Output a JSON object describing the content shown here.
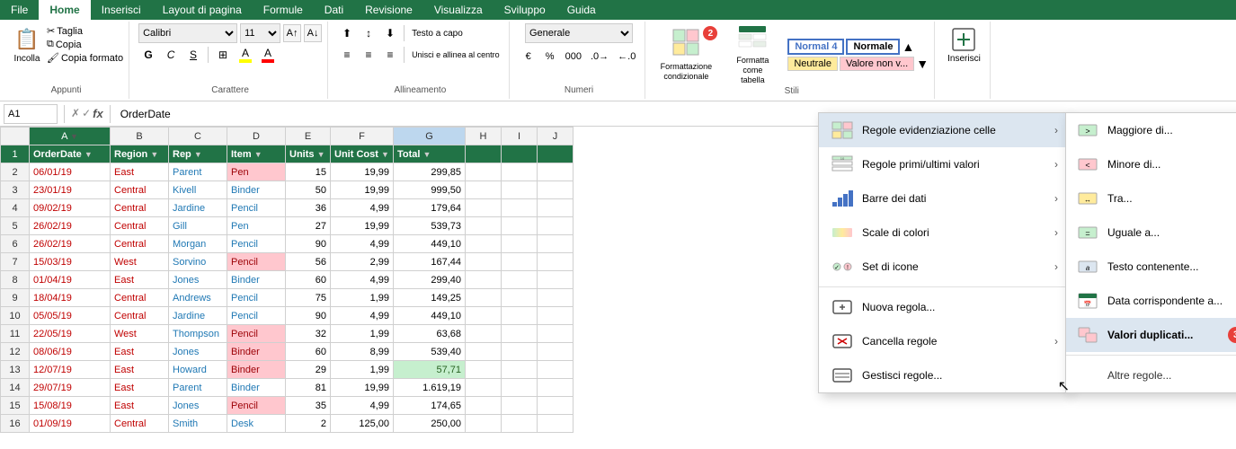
{
  "ribbon": {
    "tabs": [
      "File",
      "Home",
      "Inserisci",
      "Layout di pagina",
      "Formule",
      "Dati",
      "Revisione",
      "Visualizza",
      "Sviluppo",
      "Guida"
    ],
    "active_tab": "Home",
    "groups": {
      "appunti": {
        "label": "Appunti",
        "paste_label": "Incolla",
        "cut_label": "Taglia",
        "copy_label": "Copia",
        "copy_format_label": "Copia formato"
      },
      "carattere": {
        "label": "Carattere",
        "font": "Calibri",
        "size": "11",
        "bold": "G",
        "italic": "C",
        "underline": "S",
        "highlight_color": "#ffff00",
        "font_color": "#ff0000"
      },
      "allineamento": {
        "label": "Allineamento",
        "wrap_text": "Testo a capo",
        "merge": "Unisci e allinea al centro"
      },
      "numeri": {
        "label": "Numeri",
        "format": "Generale"
      },
      "stili": {
        "label": "Stili",
        "cf_label": "Formattazione\ncondizionale",
        "format_as_table_label": "Formatta come\ntabella",
        "normal4": "Normal 4",
        "normale": "Normale",
        "neutrale": "Neutrale",
        "valore_non_v": "Valore non v..."
      }
    }
  },
  "formula_bar": {
    "cell_ref": "A1",
    "formula": "OrderDate"
  },
  "columns": [
    "A",
    "B",
    "C",
    "D",
    "E",
    "F",
    "G",
    "H",
    "I",
    "J"
  ],
  "column_headers": [
    "OrderDate",
    "Region",
    "Rep",
    "Item",
    "Units",
    "Unit Cost",
    "Total",
    "",
    "",
    ""
  ],
  "rows": [
    [
      "06/01/19",
      "East",
      "Parent",
      "Pen",
      "15",
      "19,99",
      "299,85",
      "",
      "",
      ""
    ],
    [
      "23/01/19",
      "Central",
      "Kivell",
      "Binder",
      "50",
      "19,99",
      "999,50",
      "",
      "",
      ""
    ],
    [
      "09/02/19",
      "Central",
      "Jardine",
      "Pencil",
      "36",
      "4,99",
      "179,64",
      "",
      "",
      ""
    ],
    [
      "26/02/19",
      "Central",
      "Gill",
      "Pen",
      "27",
      "19,99",
      "539,73",
      "",
      "",
      ""
    ],
    [
      "26/02/19",
      "Central",
      "Morgan",
      "Pencil",
      "90",
      "4,99",
      "449,10",
      "",
      "",
      ""
    ],
    [
      "15/03/19",
      "West",
      "Sorvino",
      "Pencil",
      "56",
      "2,99",
      "167,44",
      "",
      "",
      ""
    ],
    [
      "01/04/19",
      "East",
      "Jones",
      "Binder",
      "60",
      "4,99",
      "299,40",
      "",
      "",
      ""
    ],
    [
      "18/04/19",
      "Central",
      "Andrews",
      "Pencil",
      "75",
      "1,99",
      "149,25",
      "",
      "",
      ""
    ],
    [
      "05/05/19",
      "Central",
      "Jardine",
      "Pencil",
      "90",
      "4,99",
      "449,10",
      "",
      "",
      ""
    ],
    [
      "22/05/19",
      "West",
      "Thompson",
      "Pencil",
      "32",
      "1,99",
      "63,68",
      "",
      "",
      ""
    ],
    [
      "08/06/19",
      "East",
      "Jones",
      "Binder",
      "60",
      "8,99",
      "539,40",
      "",
      "",
      ""
    ],
    [
      "12/07/19",
      "East",
      "Howard",
      "Binder",
      "29",
      "1,99",
      "57,71",
      "",
      "",
      ""
    ],
    [
      "29/07/19",
      "East",
      "Parent",
      "Binder",
      "81",
      "19,99",
      "1.619,19",
      "",
      "",
      ""
    ],
    [
      "15/08/19",
      "East",
      "Jones",
      "Pencil",
      "35",
      "4,99",
      "174,65",
      "",
      "",
      ""
    ],
    [
      "01/09/19",
      "Central",
      "Smith",
      "Desk",
      "2",
      "125,00",
      "250,00",
      "",
      "",
      ""
    ]
  ],
  "row_styles": {
    "2": {
      "item_col": "pink-bg"
    },
    "7": {
      "item_col": "pink-bg"
    },
    "11": {
      "item_col": "pink-bg"
    },
    "12": {
      "item_col": "pink-bg"
    },
    "13": {
      "item_col": "pink-bg",
      "total_col": "green-bg"
    },
    "15": {
      "item_col": "pink-bg"
    }
  },
  "red_regions": [
    1,
    2,
    3,
    4,
    5,
    6,
    7,
    8,
    9,
    10,
    11,
    12,
    13,
    14,
    15
  ],
  "blue_reps": [
    1,
    2,
    3,
    4,
    5,
    6,
    7,
    8,
    9,
    10,
    11,
    12,
    13,
    14,
    15
  ],
  "dropdown_menu": {
    "items": [
      {
        "icon": "grid-icon",
        "label": "Regole evidenziazione celle",
        "has_arrow": true
      },
      {
        "icon": "grid-icon",
        "label": "Regole primi/ultimi valori",
        "has_arrow": true
      },
      {
        "icon": "bars-icon",
        "label": "Barre dei dati",
        "has_arrow": true
      },
      {
        "icon": "color-scale-icon",
        "label": "Scale di colori",
        "has_arrow": true
      },
      {
        "icon": "icons-set-icon",
        "label": "Set di icone",
        "has_arrow": true
      },
      {
        "divider": true
      },
      {
        "icon": "new-rule-icon",
        "label": "Nuova regola..."
      },
      {
        "icon": "clear-rule-icon",
        "label": "Cancella regole",
        "has_arrow": true
      },
      {
        "icon": "manage-rule-icon",
        "label": "Gestisci regole..."
      }
    ]
  },
  "dropdown_right": {
    "items": [
      {
        "label": "Maggiore di..."
      },
      {
        "label": "Minore di..."
      },
      {
        "label": "Tra..."
      },
      {
        "label": "Uguale a..."
      },
      {
        "label": "Testo contenente..."
      },
      {
        "label": "Data corrispondente a..."
      },
      {
        "label": "Valori duplicati...",
        "badge": "3"
      },
      {
        "label": "Altre regole..."
      }
    ]
  },
  "badges": {
    "cf": "2",
    "valori_duplicati": "3"
  }
}
